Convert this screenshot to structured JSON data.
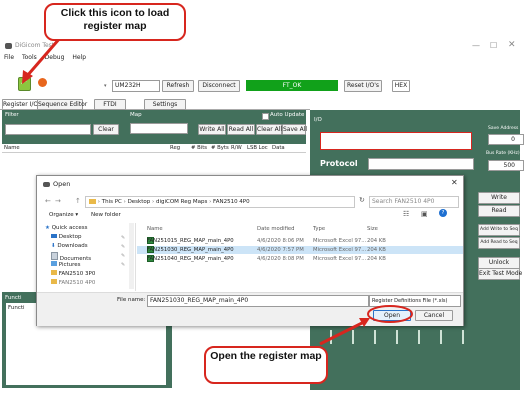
{
  "app": {
    "title": "DiGicom Test",
    "menu": [
      "File",
      "Tools",
      "Debug",
      "Help"
    ],
    "port_value": "UM232H",
    "refresh_label": "Refresh",
    "disconnect_label": "Disconnect",
    "status_text": "FT_OK",
    "reset_label": "Reset I/O's",
    "hex_label": "HEX",
    "tabs": [
      "Register I/O",
      "Sequence Editor",
      "FTDI",
      "Settings"
    ],
    "filter_label": "Filter",
    "map_label": "Map",
    "clear_label": "Clear",
    "write_all_label": "Write All",
    "read_all_label": "Read All",
    "clear_all_label": "Clear All",
    "save_all_label": "Save All",
    "auto_update_label": "Auto Update",
    "columns": [
      "Name",
      "Reg",
      "# Bits",
      "# Byts",
      "R/W",
      "LSB Loc",
      "Data"
    ],
    "io_label": "I/O",
    "save_address_label": "Save Address",
    "save_address_value": "0",
    "bus_rate_label": "Bus Rate (KHz)",
    "bus_rate_value": "500",
    "protocol_label": "Protocol",
    "right_buttons": [
      "Write",
      "Read",
      "Add Write to Seq",
      "Add Read to Seq",
      "Unlock",
      "Exit Test Mode"
    ],
    "func_label": "Functi"
  },
  "dialog": {
    "title": "Open",
    "breadcrumb": [
      "This PC",
      "Desktop",
      "digiCOM Reg Maps",
      "FAN2510 4P0"
    ],
    "search_placeholder": "Search FAN2510 4P0",
    "organize_label": "Organize ▾",
    "new_folder_label": "New folder",
    "nav_items": [
      "Quick access",
      "Desktop",
      "Downloads",
      "Documents",
      "Pictures",
      "FAN2510 3P0",
      "FAN2510 4P0"
    ],
    "columns": [
      "Name",
      "Date modified",
      "Type",
      "Size"
    ],
    "files": [
      {
        "name": "FAN251015_REG_MAP_main_4P0",
        "date": "4/6/2020 8:06 PM",
        "type": "Microsoft Excel 97...",
        "size": "204 KB"
      },
      {
        "name": "FAN251030_REG_MAP_main_4P0",
        "date": "4/6/2020 7:57 PM",
        "type": "Microsoft Excel 97...",
        "size": "204 KB"
      },
      {
        "name": "FAN251040_REG_MAP_main_4P0",
        "date": "4/6/2020 8:08 PM",
        "type": "Microsoft Excel 97...",
        "size": "204 KB"
      }
    ],
    "file_name_label": "File name:",
    "file_name_value": "FAN251030_REG_MAP_main_4P0",
    "file_type_value": "Register Definitions File (*.xls)",
    "open_label": "Open",
    "cancel_label": "Cancel"
  },
  "callouts": {
    "top": "Click this icon to load register map",
    "bottom": "Open the register map"
  },
  "colors": {
    "accent": "#d7261e",
    "panel": "#43705c",
    "status": "#11a11a"
  }
}
